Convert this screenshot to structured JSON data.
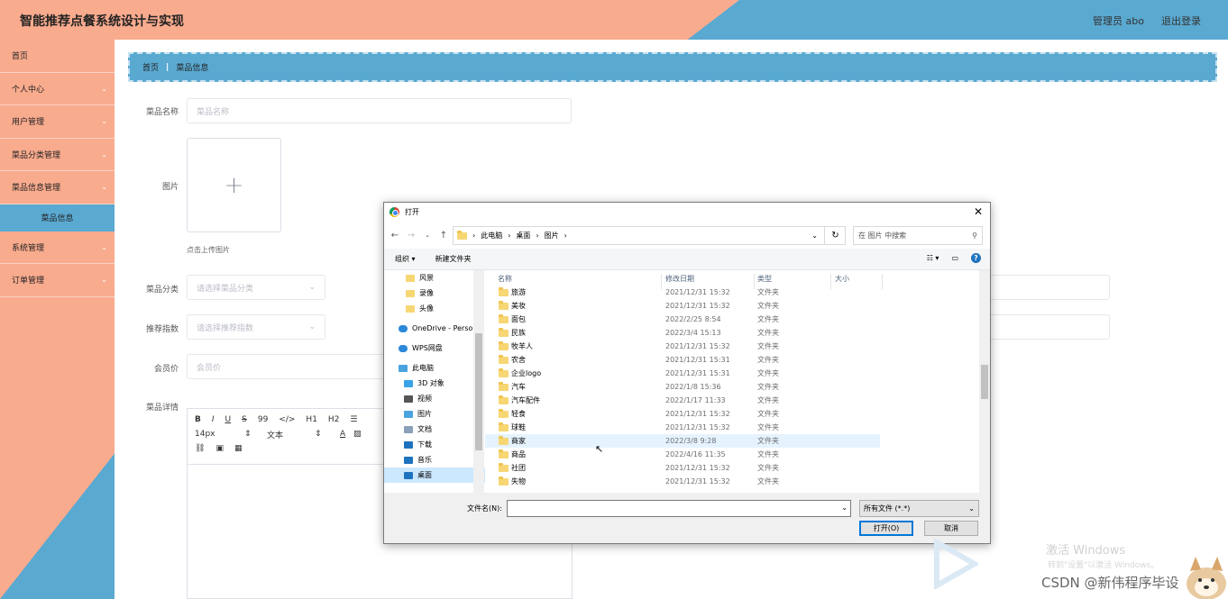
{
  "header": {
    "title": "智能推荐点餐系统设计与实现",
    "admin": "管理员 abo",
    "logout": "退出登录"
  },
  "sidebar": {
    "items": [
      {
        "label": "首页",
        "chev": ""
      },
      {
        "label": "个人中心",
        "chev": "⌄"
      },
      {
        "label": "用户管理",
        "chev": "⌄"
      },
      {
        "label": "菜品分类管理",
        "chev": "⌄"
      },
      {
        "label": "菜品信息管理",
        "chev": "⌄"
      }
    ],
    "sub_item": "菜品信息",
    "items2": [
      {
        "label": "系统管理",
        "chev": "⌄"
      },
      {
        "label": "订单管理",
        "chev": "⌄"
      }
    ]
  },
  "breadcrumb": {
    "home": "首页",
    "sep": "|",
    "current": "菜品信息"
  },
  "form": {
    "name_label": "菜品名称",
    "name_placeholder": "菜品名称",
    "image_label": "图片",
    "upload_plus": "+",
    "upload_tip": "点击上传图片",
    "category_label": "菜品分类",
    "category_placeholder": "请选择菜品分类",
    "recommend_label": "推荐指数",
    "recommend_placeholder": "请选择推荐指数",
    "price_label": "会员价",
    "price_placeholder": "会员价",
    "detail_label": "菜品详情",
    "toolbar_row1": [
      "B",
      "I",
      "U",
      "S",
      "99",
      "</>",
      "H1",
      "H2",
      "☰"
    ],
    "font_size": "14px",
    "font_style": "文本",
    "toolbar_row2_extra": [
      "A",
      "▨"
    ]
  },
  "dialog": {
    "title": "打开",
    "path": [
      "此电脑",
      "桌面",
      "图片"
    ],
    "search_placeholder": "在 图片 中搜索",
    "organize": "组织 ▾",
    "new_folder": "新建文件夹",
    "nav": [
      {
        "label": "风景",
        "icon": "folder"
      },
      {
        "label": "录像",
        "icon": "folder"
      },
      {
        "label": "头像",
        "icon": "folder"
      },
      {
        "label": "OneDrive - Perso",
        "icon": "cloud"
      },
      {
        "label": "WPS网盘",
        "icon": "cloud"
      },
      {
        "label": "此电脑",
        "icon": "pc"
      },
      {
        "label": "3D 对象",
        "icon": "cube"
      },
      {
        "label": "视频",
        "icon": "video"
      },
      {
        "label": "图片",
        "icon": "pic"
      },
      {
        "label": "文档",
        "icon": "doc"
      },
      {
        "label": "下载",
        "icon": "down"
      },
      {
        "label": "音乐",
        "icon": "music"
      },
      {
        "label": "桌面",
        "icon": "desk"
      }
    ],
    "columns": {
      "name": "名称",
      "date": "修改日期",
      "type": "类型",
      "size": "大小"
    },
    "files": [
      {
        "name": "旅游",
        "date": "2021/12/31 15:32",
        "type": "文件夹"
      },
      {
        "name": "美妆",
        "date": "2021/12/31 15:32",
        "type": "文件夹"
      },
      {
        "name": "面包",
        "date": "2022/2/25 8:54",
        "type": "文件夹"
      },
      {
        "name": "民族",
        "date": "2022/3/4 15:13",
        "type": "文件夹"
      },
      {
        "name": "牧羊人",
        "date": "2021/12/31 15:32",
        "type": "文件夹"
      },
      {
        "name": "农舍",
        "date": "2021/12/31 15:31",
        "type": "文件夹"
      },
      {
        "name": "企业logo",
        "date": "2021/12/31 15:31",
        "type": "文件夹"
      },
      {
        "name": "汽车",
        "date": "2022/1/8 15:36",
        "type": "文件夹"
      },
      {
        "name": "汽车配件",
        "date": "2022/1/17 11:33",
        "type": "文件夹"
      },
      {
        "name": "轻食",
        "date": "2021/12/31 15:32",
        "type": "文件夹"
      },
      {
        "name": "球鞋",
        "date": "2021/12/31 15:32",
        "type": "文件夹"
      },
      {
        "name": "商家",
        "date": "2022/3/8 9:28",
        "type": "文件夹"
      },
      {
        "name": "商品",
        "date": "2022/4/16 11:35",
        "type": "文件夹"
      },
      {
        "name": "社团",
        "date": "2021/12/31 15:32",
        "type": "文件夹"
      },
      {
        "name": "失物",
        "date": "2021/12/31 15:32",
        "type": "文件夹"
      }
    ],
    "filename_label": "文件名(N):",
    "filetype": "所有文件 (*.*)",
    "open_btn": "打开(O)",
    "cancel_btn": "取消"
  },
  "overlay": {
    "activate": "激活 Windows",
    "activate_sub": "转到\"设置\"以激活 Windows。",
    "csdn": "CSDN @新伟程序毕设"
  }
}
